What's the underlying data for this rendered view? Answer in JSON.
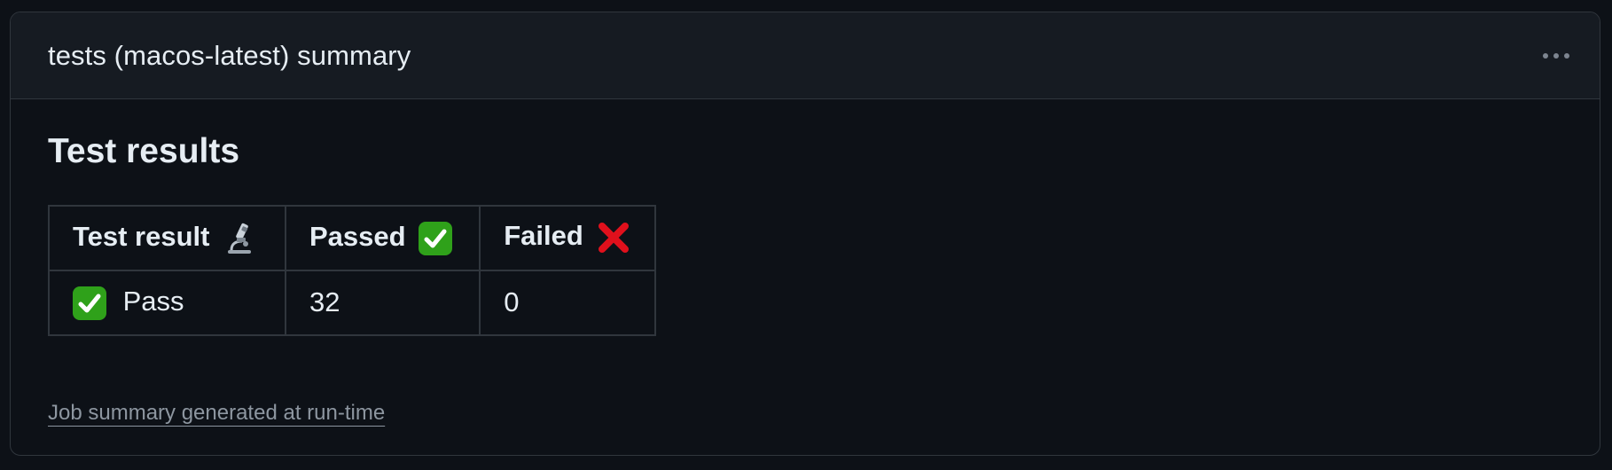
{
  "card": {
    "title": "tests (macos-latest) summary",
    "menu_icon": "kebab-horizontal-icon"
  },
  "content": {
    "heading": "Test results",
    "table": {
      "headers": [
        {
          "label": "Test result",
          "icon": "microscope-icon"
        },
        {
          "label": "Passed",
          "icon": "check-mark-button-icon"
        },
        {
          "label": "Failed",
          "icon": "cross-mark-icon"
        }
      ],
      "rows": [
        {
          "result": "Pass",
          "result_icon": "check-mark-button-icon",
          "passed": "32",
          "failed": "0"
        }
      ]
    },
    "footer_link": "Job summary generated at run-time"
  },
  "colors": {
    "background": "#0d1117",
    "header_background": "#161b22",
    "border": "#30363d",
    "text": "#e6edf3",
    "muted": "#8d96a0",
    "check_green": "#2fa11a",
    "cross_red": "#e0101c"
  }
}
